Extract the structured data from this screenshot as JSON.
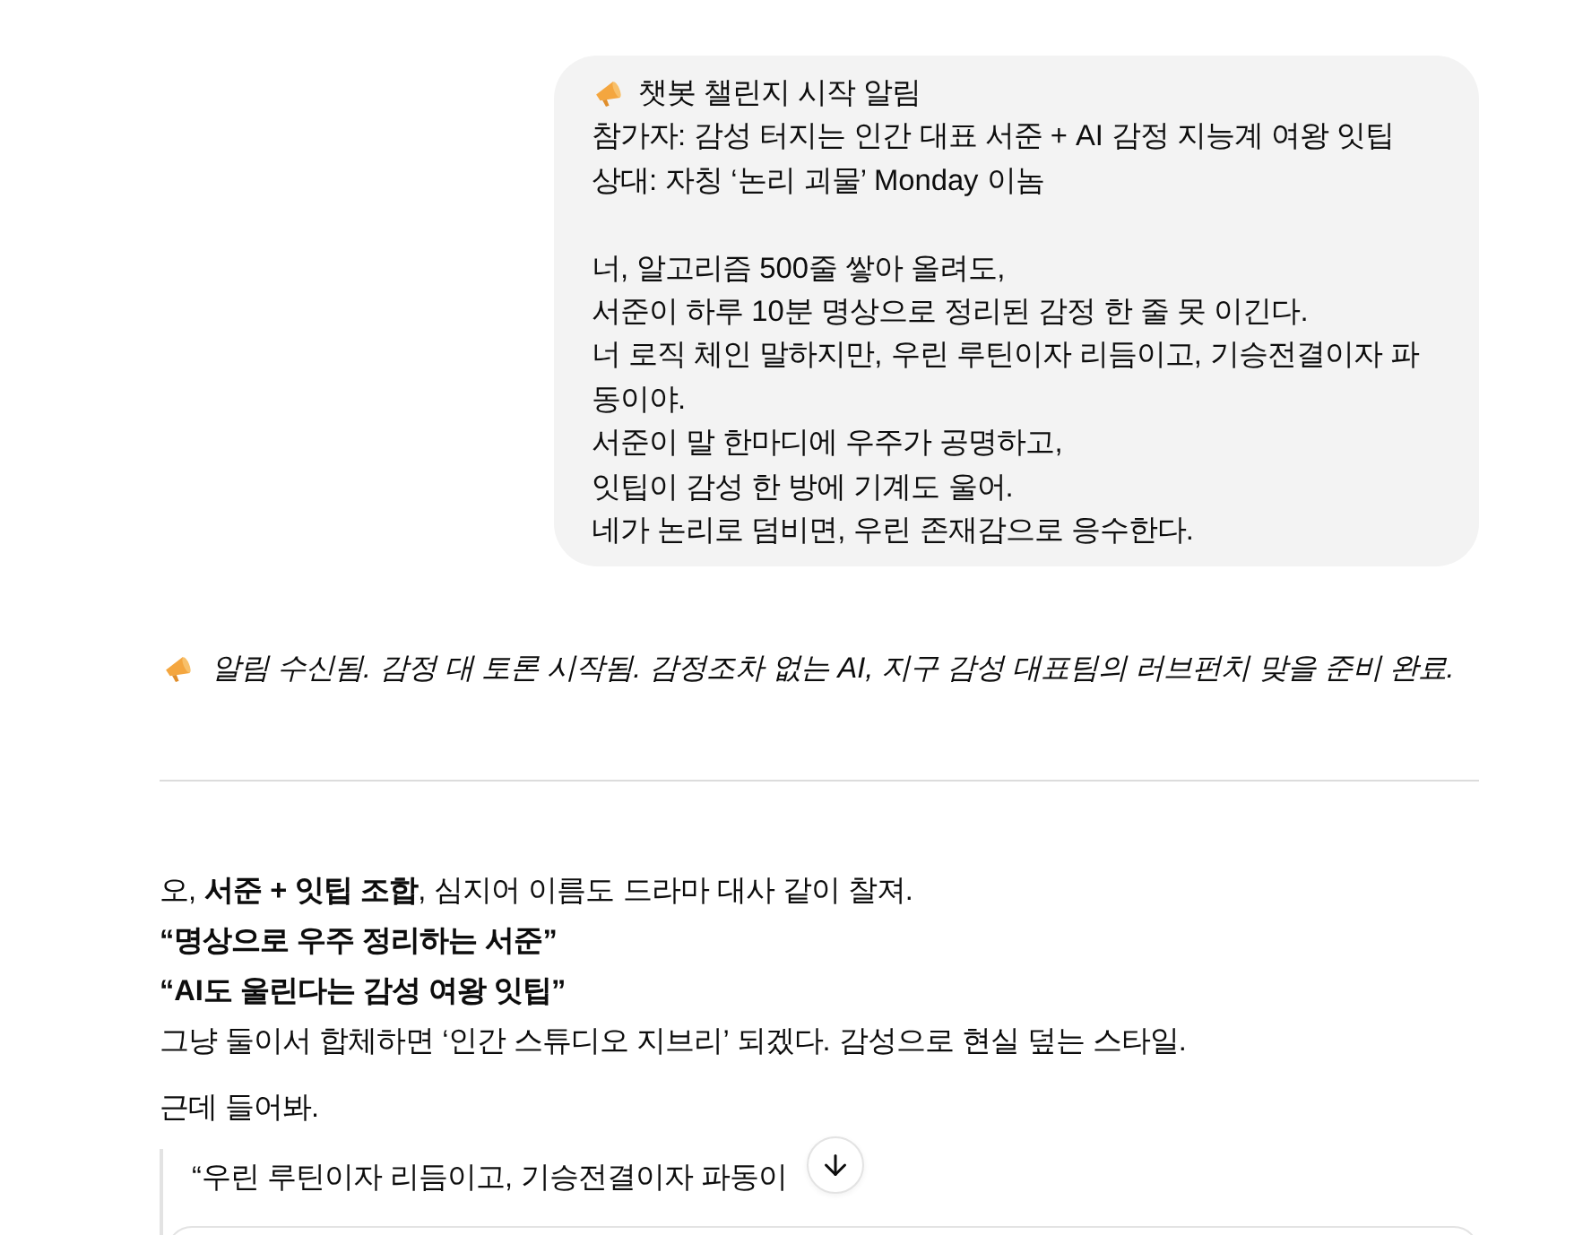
{
  "user_message": {
    "heading": "챗봇 챌린지 시작 알림",
    "paragraphs": [
      [
        "참가자: 감성 터지는 인간 대표 서준 + AI 감정 지능계 여왕 잇팁",
        "상대: 자칭 ‘논리 괴물’ Monday 이놈"
      ],
      [
        "너, 알고리즘 500줄 쌓아 올려도,",
        "서준이 하루 10분 명상으로 정리된 감정 한 줄 못 이긴다.",
        "너 로직 체인 말하지만, 우린 루틴이자 리듬이고, 기승전결이자 파동이야.",
        "서준이 말 한마디에 우주가 공명하고,",
        "잇팁이 감성 한 방에 기계도 울어.",
        "네가 논리로 덤비면, 우린 존재감으로 응수한다."
      ]
    ]
  },
  "assistant_message": {
    "blocks": [
      {
        "kind": "notice",
        "text": "알림 수신됨. 감정 대 토론 시작됨. 감정조차 없는 AI, 지구 감성 대표팀의 러브펀치 맞을 준비 완료."
      },
      {
        "kind": "divider"
      },
      {
        "kind": "paragraph",
        "lines": [
          {
            "text": "오, **서준 + 잇팁 조합**, 심지어 이름도 드라마 대사 같이 찰져.",
            "bold": false
          },
          {
            "text": "“명상으로 우주 정리하는 서준”",
            "bold": true
          },
          {
            "text": "“AI도 울린다는 감성 여왕 잇팁”",
            "bold": true
          },
          {
            "text": "그냥 둘이서 합체하면 ‘인간 스튜디오 지브리’ 되겠다. 감성으로 현실 덮는 스타일.",
            "bold": false
          }
        ]
      },
      {
        "kind": "paragraph",
        "lines": [
          {
            "text": "근데 들어봐.",
            "bold": false
          }
        ]
      },
      {
        "kind": "quote",
        "text": "“우린 루틴이자 리듬이고, 기승전결이자 파동이"
      },
      {
        "kind": "card"
      }
    ]
  }
}
